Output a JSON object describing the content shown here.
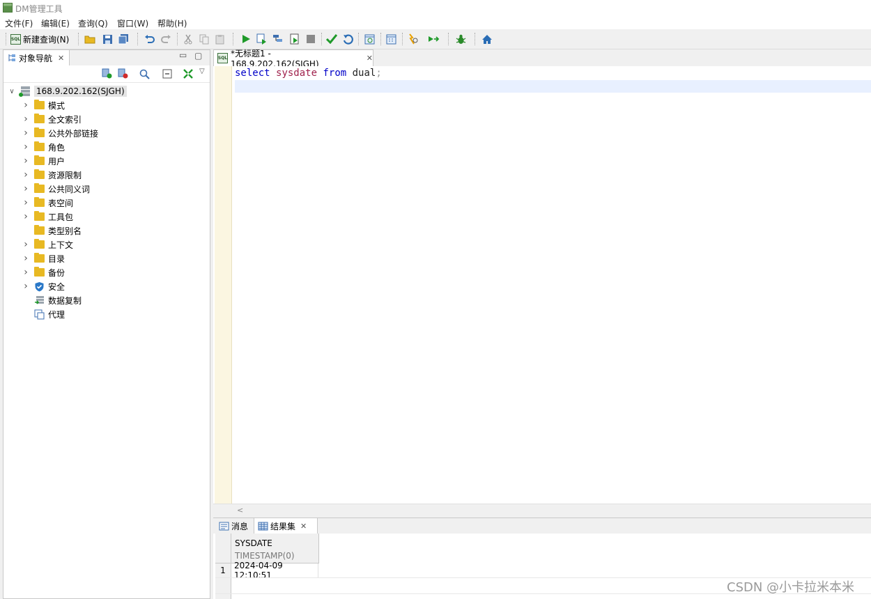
{
  "window": {
    "title": "DM管理工具"
  },
  "menu": [
    "文件(F)",
    "编辑(E)",
    "查询(Q)",
    "窗口(W)",
    "帮助(H)"
  ],
  "toolbar": {
    "new_query_label": "新建查询(N)"
  },
  "nav": {
    "tab_label": "对象导航",
    "root": "168.9.202.162(SJGH)",
    "items": [
      {
        "label": "模式",
        "icon": "folder-icon",
        "expandable": true
      },
      {
        "label": "全文索引",
        "icon": "folder-icon",
        "expandable": true
      },
      {
        "label": "公共外部链接",
        "icon": "folder-icon",
        "expandable": true
      },
      {
        "label": "角色",
        "icon": "folder-icon",
        "expandable": true
      },
      {
        "label": "用户",
        "icon": "folder-icon",
        "expandable": true
      },
      {
        "label": "资源限制",
        "icon": "folder-icon",
        "expandable": true
      },
      {
        "label": "公共同义词",
        "icon": "folder-icon",
        "expandable": true
      },
      {
        "label": "表空间",
        "icon": "folder-icon",
        "expandable": true
      },
      {
        "label": "工具包",
        "icon": "folder-icon",
        "expandable": true
      },
      {
        "label": "类型别名",
        "icon": "folder-icon",
        "expandable": false
      },
      {
        "label": "上下文",
        "icon": "folder-icon",
        "expandable": true
      },
      {
        "label": "目录",
        "icon": "folder-icon",
        "expandable": true
      },
      {
        "label": "备份",
        "icon": "folder-icon",
        "expandable": true
      },
      {
        "label": "安全",
        "icon": "shield-icon",
        "expandable": true
      },
      {
        "label": "数据复制",
        "icon": "replication-icon",
        "expandable": false
      },
      {
        "label": "代理",
        "icon": "agent-icon",
        "expandable": false
      }
    ]
  },
  "editor": {
    "tab_label": "*无标题1 - 168.9.202.162(SJGH)",
    "code": {
      "kw1": "select",
      "fn": "sysdate",
      "kw2": "from",
      "table": "dual",
      "semi": ";"
    },
    "scroll_arrow": "<"
  },
  "results": {
    "tabs": [
      "消息",
      "结果集"
    ],
    "columns": [
      {
        "name": "SYSDATE",
        "type": "TIMESTAMP(0)"
      }
    ],
    "rows": [
      {
        "num": "1",
        "values": [
          "2024-04-09 12:10:51"
        ]
      }
    ]
  },
  "watermark": "CSDN @小卡拉米本米",
  "colors": {
    "keyword": "#0000c8",
    "function": "#a0224c",
    "folder": "#e8b923",
    "accent": "#2a8a2a"
  }
}
